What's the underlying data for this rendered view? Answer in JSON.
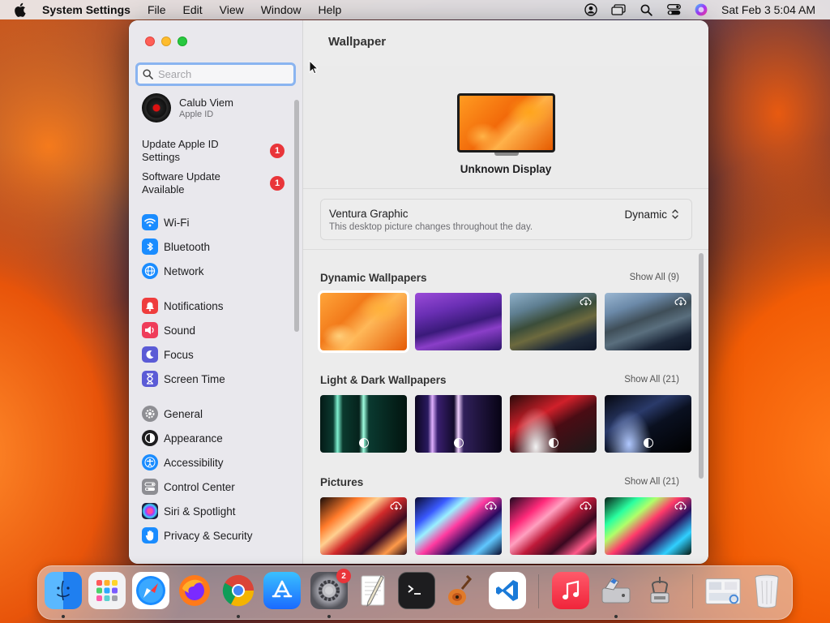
{
  "menubar": {
    "app_name": "System Settings",
    "menus": [
      "File",
      "Edit",
      "View",
      "Window",
      "Help"
    ],
    "clock": "Sat Feb 3  5:04 AM"
  },
  "sidebar": {
    "search_placeholder": "Search",
    "account": {
      "name": "Calub Viem",
      "subtitle": "Apple ID"
    },
    "alerts": [
      {
        "label": "Update Apple ID Settings",
        "badge": "1"
      },
      {
        "label": "Software Update Available",
        "badge": "1"
      }
    ],
    "items": [
      {
        "label": "Wi-Fi",
        "icon": "wifi-icon",
        "color": "#1a8cff"
      },
      {
        "label": "Bluetooth",
        "icon": "bluetooth-icon",
        "color": "#1a8cff"
      },
      {
        "label": "Network",
        "icon": "network-icon",
        "color": "#1a8cff"
      },
      {
        "label": "Notifications",
        "icon": "notifications-icon",
        "color": "#ef3d3d"
      },
      {
        "label": "Sound",
        "icon": "sound-icon",
        "color": "#ef3d5a"
      },
      {
        "label": "Focus",
        "icon": "focus-icon",
        "color": "#5b5bd6"
      },
      {
        "label": "Screen Time",
        "icon": "screen-time-icon",
        "color": "#5b5bd6"
      },
      {
        "label": "General",
        "icon": "gear-icon",
        "color": "#8e8e93"
      },
      {
        "label": "Appearance",
        "icon": "appearance-icon",
        "color": "#1d1d1f"
      },
      {
        "label": "Accessibility",
        "icon": "accessibility-icon",
        "color": "#1a8cff"
      },
      {
        "label": "Control Center",
        "icon": "control-center-icon",
        "color": "#8e8e93"
      },
      {
        "label": "Siri & Spotlight",
        "icon": "siri-icon",
        "color": "#2a2a4a"
      },
      {
        "label": "Privacy & Security",
        "icon": "hand-icon",
        "color": "#1a8cff"
      }
    ]
  },
  "content": {
    "title": "Wallpaper",
    "display_name": "Unknown Display",
    "current": {
      "name": "Ventura Graphic",
      "description": "This desktop picture changes throughout the day.",
      "mode": "Dynamic"
    },
    "sections": [
      {
        "title": "Dynamic Wallpapers",
        "show_all": "Show All (9)"
      },
      {
        "title": "Light & Dark Wallpapers",
        "show_all": "Show All (21)"
      },
      {
        "title": "Pictures",
        "show_all": "Show All (21)"
      }
    ]
  },
  "dock": {
    "apps": [
      "finder-icon",
      "launchpad-icon",
      "safari-icon",
      "firefox-icon",
      "chrome-icon",
      "app-store-icon",
      "system-settings-icon",
      "textedit-icon",
      "terminal-icon",
      "instruments-icon",
      "vscode-icon",
      "music-icon",
      "disk-utility-icon",
      "archive-utility-icon",
      "preview-icon",
      "trash-icon"
    ],
    "settings_badge": "2"
  }
}
